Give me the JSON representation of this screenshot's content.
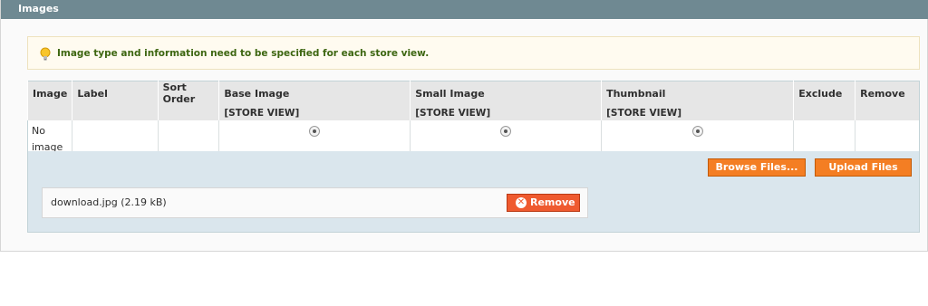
{
  "section": {
    "title": "Images"
  },
  "notice": {
    "text": "Image type and information need to be specified for each store view."
  },
  "grid": {
    "columns": [
      "Image",
      "Label",
      "Sort Order",
      "Base Image",
      "Small Image",
      "Thumbnail",
      "Exclude",
      "Remove"
    ],
    "scope_labels": {
      "base": "[STORE VIEW]",
      "small": "[STORE VIEW]",
      "thumbnail": "[STORE VIEW]"
    },
    "row": {
      "image": "No image",
      "label": "",
      "sort_order": ""
    }
  },
  "uploader": {
    "browse_label": "Browse Files...",
    "upload_label": "Upload Files",
    "file": {
      "name": "download.jpg (2.19 kB)",
      "remove_label": "Remove"
    }
  },
  "colors": {
    "header_bg": "#6f8992",
    "button_orange": "#f47e23",
    "remove_red": "#ef5a2f",
    "uploader_bg": "#dae6ed"
  }
}
